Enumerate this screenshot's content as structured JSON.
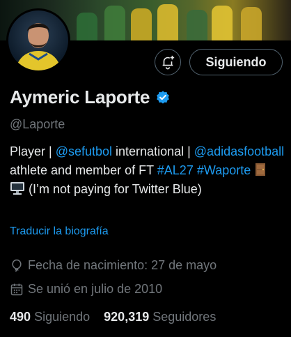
{
  "profile": {
    "name": "Aymeric Laporte",
    "handle": "@Laporte",
    "verified": true,
    "accent_color": "#1d9bf0"
  },
  "actions": {
    "notify_icon": "bell-plus-icon",
    "follow_label": "Siguiendo"
  },
  "bio": {
    "p1": "Player | ",
    "link1": "@sefutbol",
    "p2": " international | ",
    "link2": "@adidasfootball",
    "p3": " athlete and member of FT ",
    "tag1": "#AL27",
    "p4": " ",
    "tag2": "#Waporte",
    "p5": " (I’m not paying for Twitter Blue)",
    "emojis": [
      "door-icon",
      "desktop-computer-icon"
    ]
  },
  "translate_label": "Traducir la biografía",
  "meta": {
    "birth_date": "Fecha de nacimiento: 27 de mayo",
    "joined": "Se unió en julio de 2010"
  },
  "stats": {
    "following_count": "490",
    "following_label": "Siguiendo",
    "followers_count": "920,319",
    "followers_label": "Seguidores"
  }
}
